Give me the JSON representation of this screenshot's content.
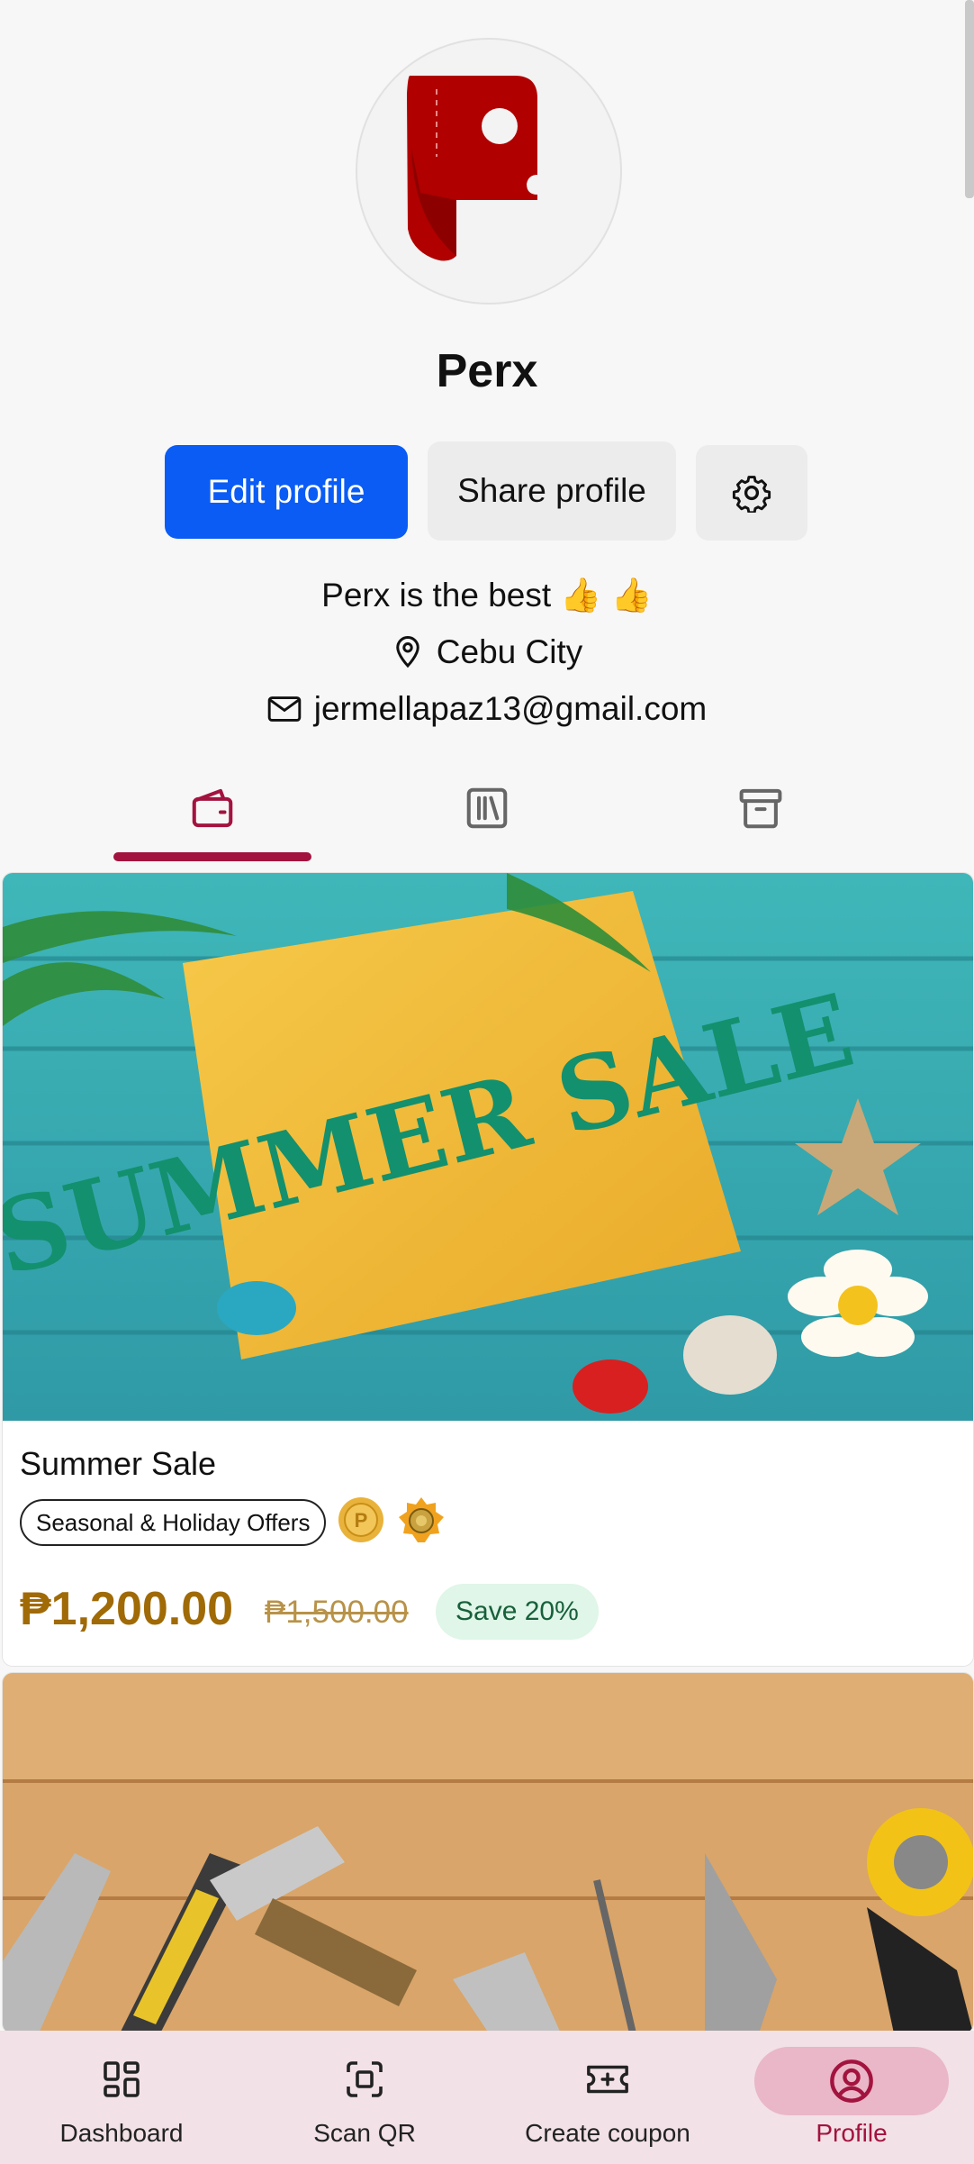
{
  "profile": {
    "name": "Perx",
    "bio": "Perx is the best 👍 👍",
    "location": "Cebu City",
    "email": "jermellapaz13@gmail.com"
  },
  "actions": {
    "edit_label": "Edit profile",
    "share_label": "Share profile"
  },
  "tabs": [
    {
      "icon": "wallet-icon",
      "active": true
    },
    {
      "icon": "library-icon",
      "active": false
    },
    {
      "icon": "archive-icon",
      "active": false
    }
  ],
  "products": [
    {
      "image_text": "SUMMER SALE",
      "title": "Summer Sale",
      "category": "Seasonal & Holiday Offers",
      "price": "₱1,200.00",
      "original_price": "₱1,500.00",
      "discount": "Save 20%"
    }
  ],
  "nav": [
    {
      "label": "Dashboard",
      "icon": "dashboard-icon",
      "active": false
    },
    {
      "label": "Scan QR",
      "icon": "scan-qr-icon",
      "active": false
    },
    {
      "label": "Create coupon",
      "icon": "create-coupon-icon",
      "active": false
    },
    {
      "label": "Profile",
      "icon": "profile-icon",
      "active": true
    }
  ],
  "colors": {
    "primary_button": "#0a5cf5",
    "accent": "#a3133f",
    "price": "#a06a06",
    "save_badge_bg": "#dff6e8",
    "nav_bg": "#f2e1e6"
  }
}
